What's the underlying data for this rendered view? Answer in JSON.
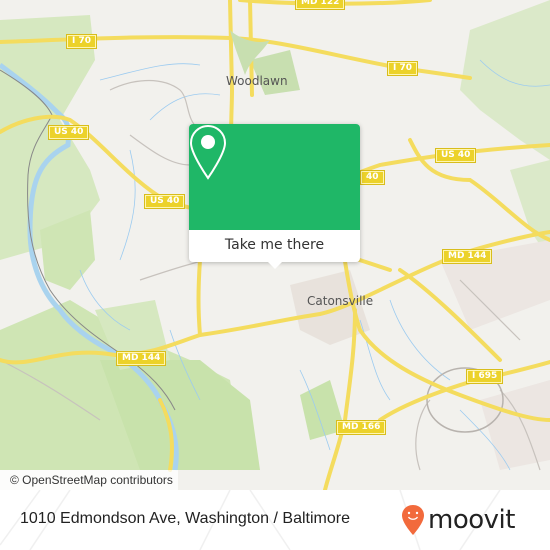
{
  "map": {
    "place_labels": [
      {
        "id": "woodlawn",
        "text": "Woodlawn"
      },
      {
        "id": "catonsville",
        "text": "Catonsville"
      }
    ],
    "road_shields": [
      {
        "id": "md122",
        "text": "MD 122"
      },
      {
        "id": "i70-west",
        "text": "I 70"
      },
      {
        "id": "i70-east",
        "text": "I 70"
      },
      {
        "id": "us40-west",
        "text": "US 40"
      },
      {
        "id": "us40-mid",
        "text": "US 40"
      },
      {
        "id": "us40-center",
        "text": "40"
      },
      {
        "id": "us40-east",
        "text": "US 40"
      },
      {
        "id": "md144-west",
        "text": "MD 144"
      },
      {
        "id": "md144-east",
        "text": "MD 144"
      },
      {
        "id": "i695",
        "text": "I 695"
      },
      {
        "id": "md166",
        "text": "MD 166"
      }
    ],
    "attribution": "© OpenStreetMap contributors"
  },
  "popup": {
    "icon": "map-pin-icon",
    "button_label": "Take me there",
    "color": "#1fb767"
  },
  "footer": {
    "address": "1010 Edmondson Ave, Washington / Baltimore",
    "logo_text": "moovit",
    "logo_color": "#f26a3c"
  }
}
